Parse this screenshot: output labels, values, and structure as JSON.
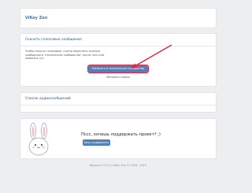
{
  "app": {
    "title": "ViKey Zen"
  },
  "download": {
    "title": "Скачать голосовые сообщения",
    "description": "Чтобы скачать голосовые, нужно переслать нужные сообщения в 'техническое сообщество', после чего они появятся тут:",
    "send_button": "Написать в техническое сообщество",
    "refresh_link": "Обновить список"
  },
  "audio_list": {
    "title": "Список аудиосообщений"
  },
  "promo": {
    "title": "Пссс, хочешь поддержать проект? ;)",
    "support_button": "Хочу поддержать"
  },
  "footer": {
    "text": "Версия: 2.75.0 | ViKey Zen © 2016 - 2019"
  },
  "icons": {
    "mascot": "bunny-mascot-icon",
    "arrow": "red-arrow-annotation"
  },
  "colors": {
    "accent": "#5181b8",
    "highlight": "#e8243f",
    "background": "#edeef0"
  }
}
